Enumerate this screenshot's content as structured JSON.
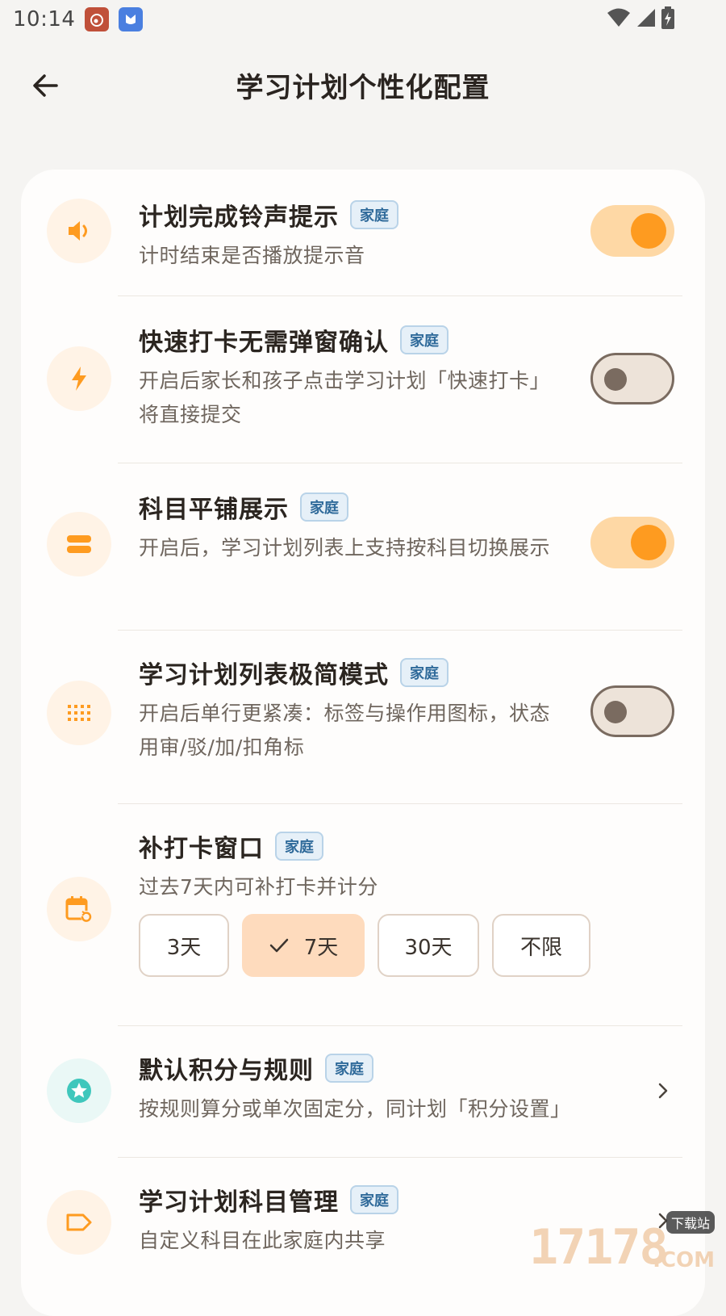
{
  "status": {
    "time": "10:14"
  },
  "header": {
    "title": "学习计划个性化配置"
  },
  "settings": [
    {
      "title": "计划完成铃声提示",
      "badge": "家庭",
      "desc": "计时结束是否播放提示音",
      "toggle": "on",
      "icon": "volume-icon"
    },
    {
      "title": "快速打卡无需弹窗确认",
      "badge": "家庭",
      "desc": "开启后家长和孩子点击学习计划「快速打卡」将直接提交",
      "toggle": "off",
      "icon": "lightning-icon"
    },
    {
      "title": "科目平铺展示",
      "badge": "家庭",
      "desc": "开启后，学习计划列表上支持按科目切换展示",
      "toggle": "on",
      "icon": "tiles-icon"
    },
    {
      "title": "学习计划列表极简模式",
      "badge": "家庭",
      "desc": "开启后单行更紧凑：标签与操作用图标，状态用审/驳/加/扣角标",
      "toggle": "off",
      "icon": "grid-dots-icon"
    }
  ],
  "makeup": {
    "title": "补打卡窗口",
    "badge": "家庭",
    "desc": "过去7天内可补打卡并计分",
    "options": [
      "3天",
      "7天",
      "30天",
      "不限"
    ],
    "selected": "7天"
  },
  "points": {
    "title": "默认积分与规则",
    "badge": "家庭",
    "desc": "按规则算分或单次固定分，同计划「积分设置」"
  },
  "subjects": {
    "title": "学习计划科目管理",
    "badge": "家庭",
    "desc": "自定义科目在此家庭内共享"
  },
  "watermark": {
    "number": "17178",
    "tag": "下载站",
    "suffix": ".COM"
  },
  "colors": {
    "accent": "#fe9b20",
    "toggle_on_track": "#fed8a5",
    "icon_bg": "#fff3e6",
    "badge_text": "#2f6a9a"
  }
}
